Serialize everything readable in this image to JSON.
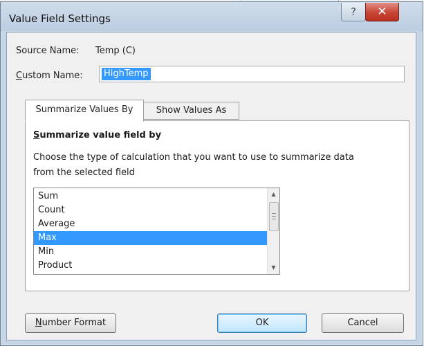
{
  "window": {
    "title": "Value Field Settings",
    "help_glyph": "?",
    "close_glyph": "✕",
    "help_icon": "help-icon",
    "close_icon": "close-icon"
  },
  "source": {
    "label": "Source Name:",
    "value": "Temp (C)"
  },
  "custom_name": {
    "label_first": "C",
    "label_rest": "ustom Name:",
    "value": "HighTemp"
  },
  "tabs": [
    {
      "label": "Summarize Values By",
      "active": true
    },
    {
      "label": "Show Values As",
      "active": false
    }
  ],
  "panel": {
    "heading_first": "S",
    "heading_rest": "ummarize value field by",
    "description": "Choose the type of calculation that you want to use to summarize data from the selected field"
  },
  "calculations": {
    "items": [
      "Sum",
      "Count",
      "Average",
      "Max",
      "Min",
      "Product"
    ],
    "selected": "Max"
  },
  "buttons": {
    "number_format_first": "N",
    "number_format_rest": "umber Format",
    "ok": "OK",
    "cancel": "Cancel"
  },
  "colors": {
    "selection": "#3399ff",
    "close_button": "#c74536",
    "title_bar": "#c6d6e6"
  }
}
